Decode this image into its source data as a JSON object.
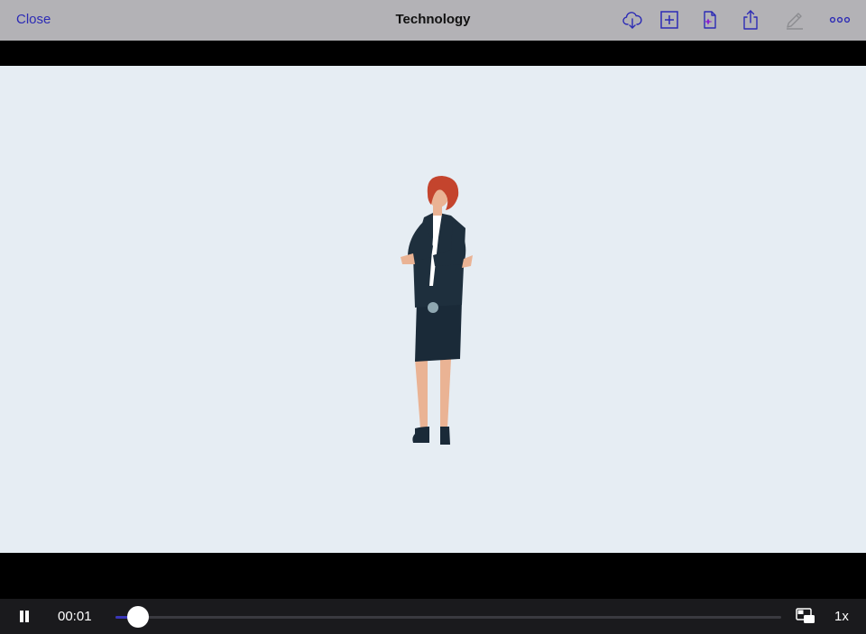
{
  "header": {
    "close_label": "Close",
    "title": "Technology",
    "icons": [
      "cloud-download-icon",
      "add-square-icon",
      "new-document-icon",
      "share-icon",
      "edit-pencil-icon",
      "more-dots-icon"
    ],
    "accent_color": "#2c2bb5"
  },
  "video": {
    "background_color": "#e6edf3",
    "scene": "woman-in-business-suit-illustration"
  },
  "player": {
    "current_time": "00:01",
    "progress_fraction": 0.034,
    "speed": "1x",
    "progress_color": "#3a36b8"
  }
}
